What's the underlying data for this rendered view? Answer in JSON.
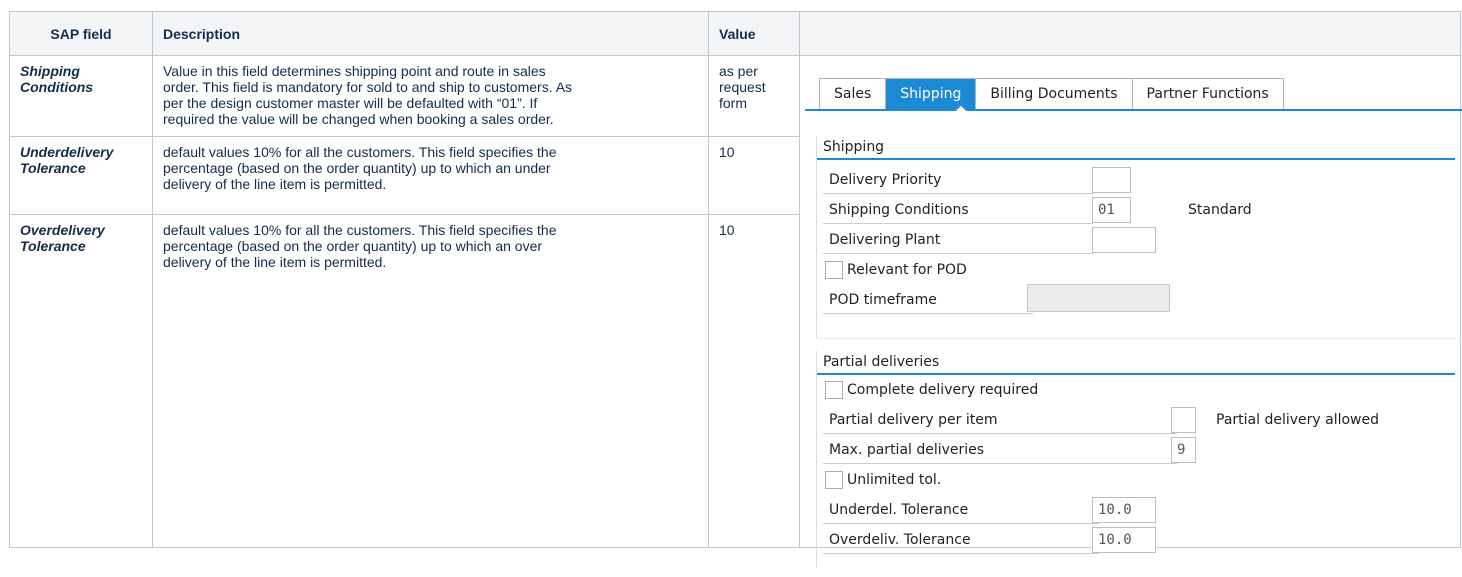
{
  "table": {
    "headers": {
      "field": "SAP field",
      "description": "Description",
      "value": "Value"
    },
    "rows": [
      {
        "field": [
          "Shipping",
          "Conditions"
        ],
        "description": [
          "Value in this field determines shipping point and route in sales",
          "order. This field is mandatory for sold to and ship to customers. As",
          "per the design customer master will be defaulted with “01”. If",
          "required the value will be changed when booking a sales order."
        ],
        "value": [
          "as per",
          "request",
          "form"
        ]
      },
      {
        "field": [
          "Underdelivery",
          "Tolerance"
        ],
        "description": [
          "default values 10% for all the customers. This field specifies the",
          "percentage (based on the order quantity) up to which an under",
          "delivery of the line item is permitted."
        ],
        "value": [
          "10"
        ]
      },
      {
        "field": [
          "Overdelivery",
          "Tolerance"
        ],
        "description": [
          "default values 10% for all the customers. This field specifies the",
          "percentage (based on the order quantity) up to which an over",
          "delivery of the line item is permitted."
        ],
        "value": [
          "10"
        ]
      }
    ]
  },
  "sap": {
    "tabs": [
      "Sales",
      "Shipping",
      "Billing Documents",
      "Partner Functions"
    ],
    "active_tab": "Shipping",
    "shipping": {
      "title": "Shipping",
      "delivery_priority_label": "Delivery Priority",
      "delivery_priority_value": "",
      "shipping_conditions_label": "Shipping Conditions",
      "shipping_conditions_value": "01",
      "shipping_conditions_text": "Standard",
      "delivering_plant_label": "Delivering Plant",
      "delivering_plant_value": "",
      "relevant_pod_label": "Relevant for POD",
      "pod_timeframe_label": "POD timeframe",
      "pod_timeframe_value": ""
    },
    "partial": {
      "title": "Partial deliveries",
      "complete_delivery_label": "Complete delivery required",
      "partial_per_item_label": "Partial delivery per item",
      "partial_per_item_value": "",
      "partial_per_item_text": "Partial delivery allowed",
      "max_partial_label": "Max. partial deliveries",
      "max_partial_value": "9",
      "unlimited_tol_label": "Unlimited tol.",
      "underdel_label": "Underdel. Tolerance",
      "underdel_value": "10.0",
      "overdeliv_label": "Overdeliv. Tolerance",
      "overdeliv_value": "10.0"
    }
  }
}
